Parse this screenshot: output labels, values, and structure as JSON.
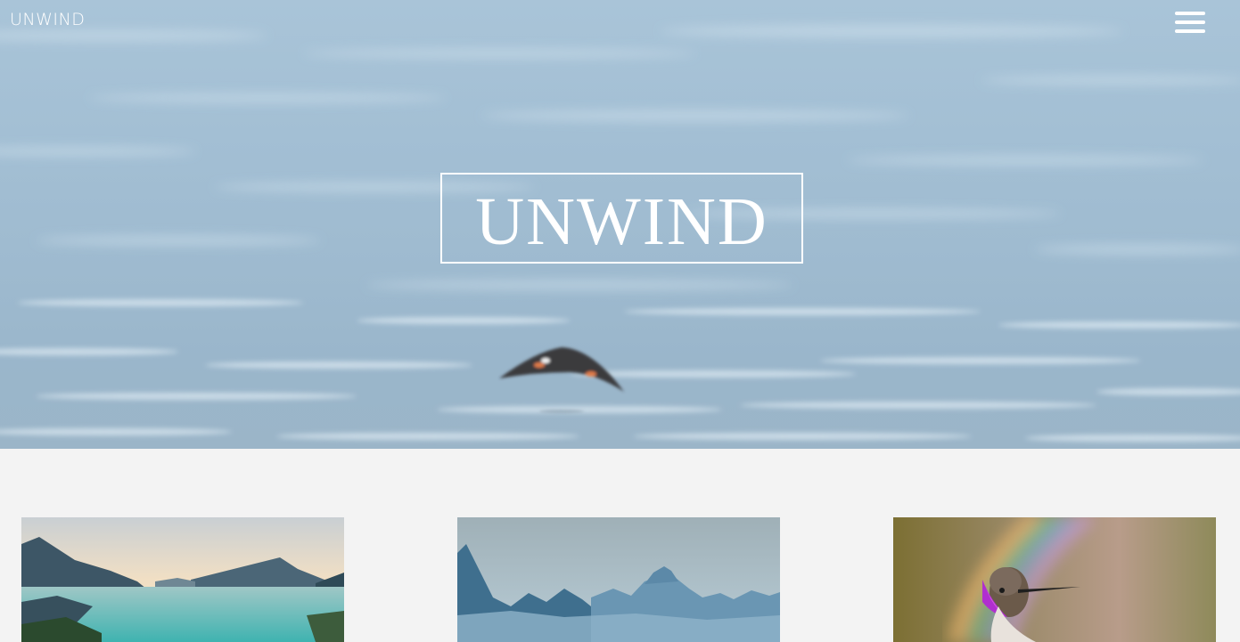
{
  "header": {
    "brand": "UNWIND",
    "menu_icon": "hamburger-menu-icon"
  },
  "hero": {
    "title": "UNWIND",
    "image": "bird-flying-over-water"
  },
  "gallery": {
    "items": [
      {
        "image": "mountain-lake-landscape"
      },
      {
        "image": "misty-blue-mountains"
      },
      {
        "image": "hummingbird-rainbow"
      }
    ]
  }
}
